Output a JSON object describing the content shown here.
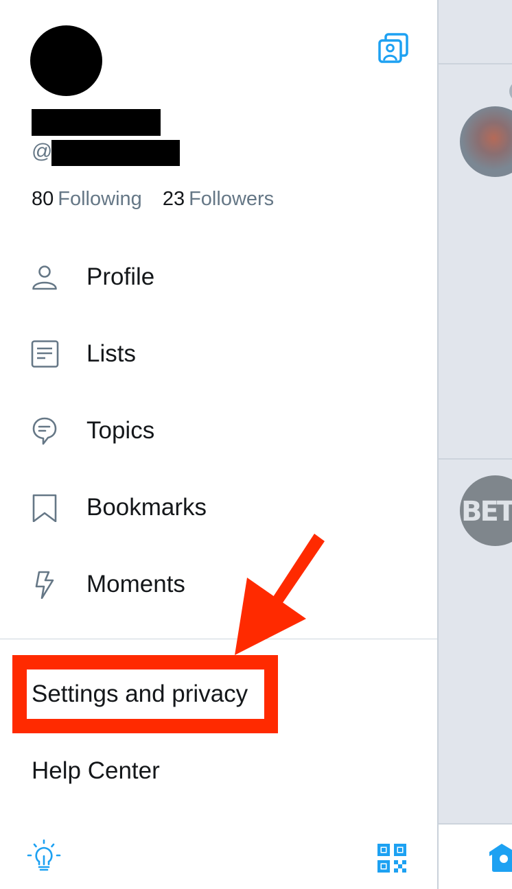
{
  "profile": {
    "handle_prefix": "@i",
    "following_count": "80",
    "following_label": "Following",
    "followers_count": "23",
    "followers_label": "Followers",
    "account_switch_icon": "account-switch-icon"
  },
  "menu": {
    "items": [
      {
        "label": "Profile",
        "icon": "person-icon"
      },
      {
        "label": "Lists",
        "icon": "list-icon"
      },
      {
        "label": "Topics",
        "icon": "topics-bubble-icon"
      },
      {
        "label": "Bookmarks",
        "icon": "bookmark-icon"
      },
      {
        "label": "Moments",
        "icon": "lightning-icon"
      }
    ],
    "settings_label": "Settings and privacy",
    "help_label": "Help Center"
  },
  "footer": {
    "left_icon": "lightbulb-icon",
    "right_icon": "qr-code-icon"
  },
  "background_timeline": {
    "avatar_2_text": "BET"
  },
  "annotation": {
    "color": "#ff2a00",
    "target": "Settings and privacy"
  },
  "colors": {
    "accent": "#1da1f2",
    "icon_gray": "#657786",
    "text": "#14171a",
    "peek_bg": "#e1e5ec"
  }
}
